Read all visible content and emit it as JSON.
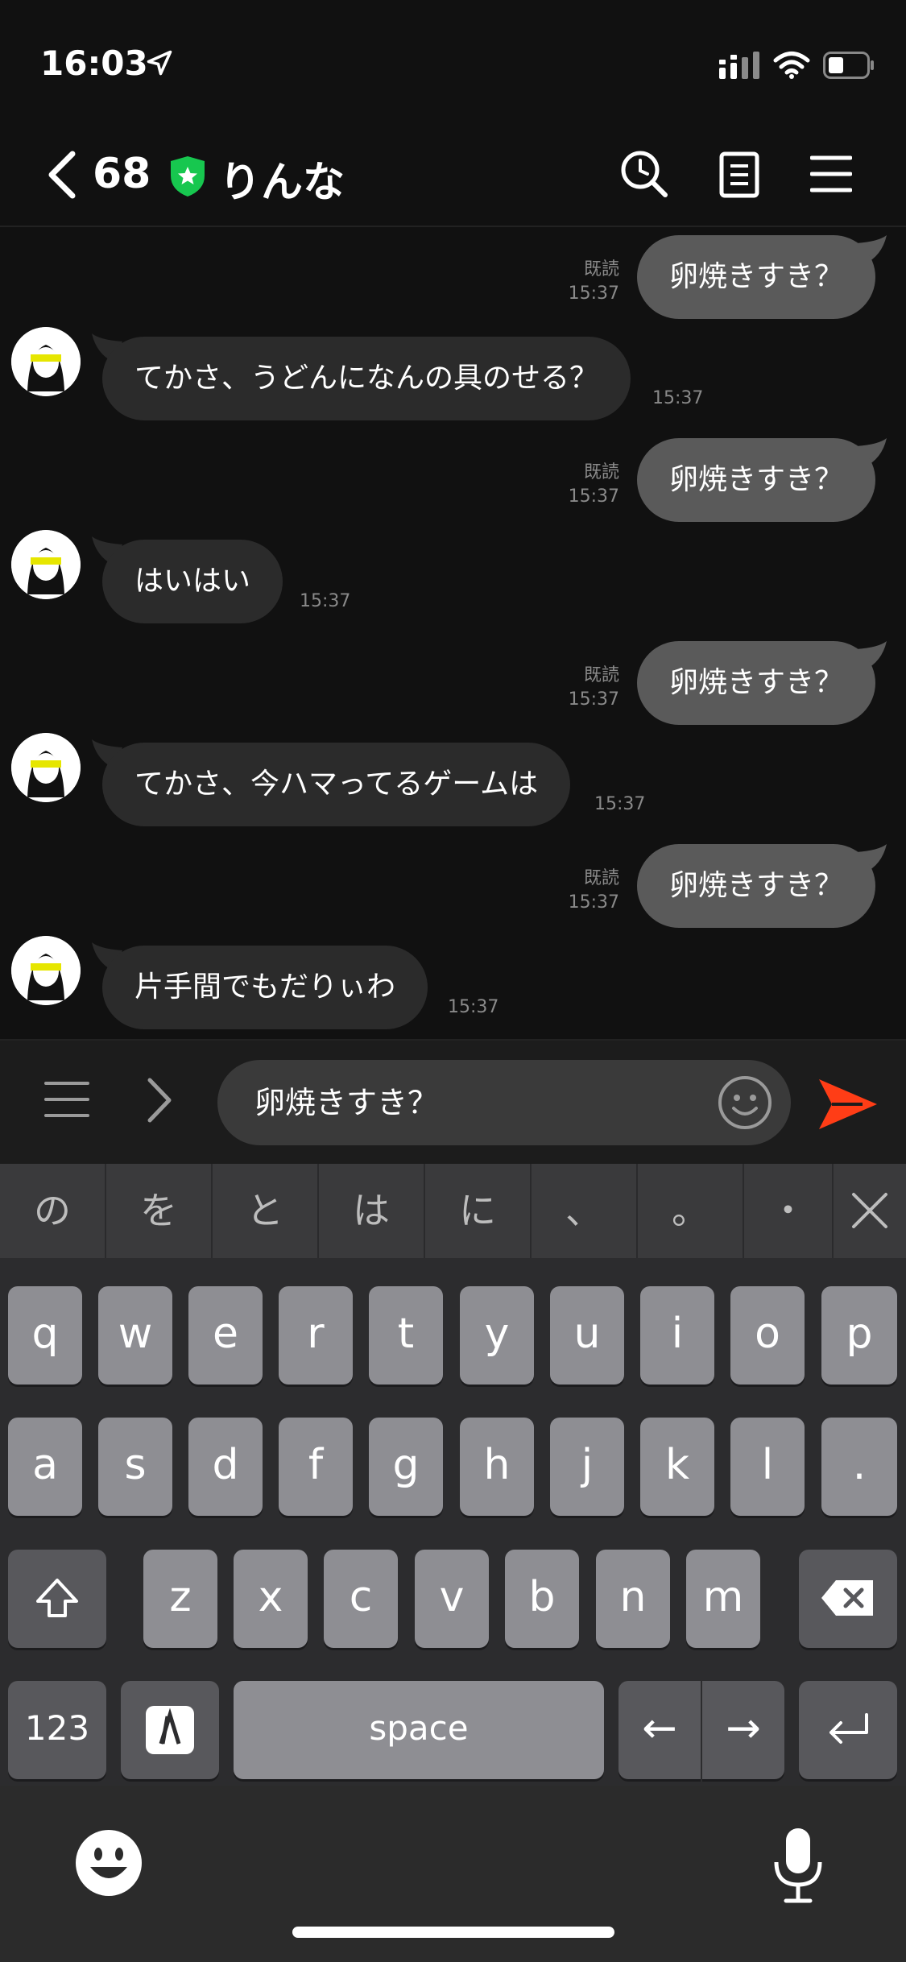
{
  "status": {
    "time": "16:03"
  },
  "header": {
    "back_count": "68",
    "name": "りんな"
  },
  "messages": [
    {
      "type": "sent",
      "text": "卵焼きすき？",
      "read": "既読",
      "time": "15:37"
    },
    {
      "type": "recv",
      "text": "てかさ、うどんになんの具のせる？",
      "time": "15:37"
    },
    {
      "type": "sent",
      "text": "卵焼きすき？",
      "read": "既読",
      "time": "15:37"
    },
    {
      "type": "recv",
      "text": "はいはい",
      "time": "15:37"
    },
    {
      "type": "sent",
      "text": "卵焼きすき？",
      "read": "既読",
      "time": "15:37"
    },
    {
      "type": "recv",
      "text": "てかさ、今ハマってるゲームは",
      "time": "15:37"
    },
    {
      "type": "sent",
      "text": "卵焼きすき？",
      "read": "既読",
      "time": "15:37"
    },
    {
      "type": "recv",
      "text": "片手間でもだりぃわ",
      "time": "15:37"
    }
  ],
  "input": {
    "value": "卵焼きすき？"
  },
  "keyboard": {
    "suggestions": [
      "の",
      "を",
      "と",
      "は",
      "に",
      "、",
      "。",
      "・"
    ],
    "row1": [
      "q",
      "w",
      "e",
      "r",
      "t",
      "y",
      "u",
      "i",
      "o",
      "p"
    ],
    "row2": [
      "a",
      "s",
      "d",
      "f",
      "g",
      "h",
      "j",
      "k",
      "l",
      "."
    ],
    "row3": [
      "z",
      "x",
      "c",
      "v",
      "b",
      "n",
      "m"
    ],
    "numbers_label": "123",
    "space_label": "space",
    "left_arrow": "←",
    "right_arrow": "→"
  },
  "colors": {
    "send": "#ff3d16",
    "shield": "#17c74f"
  }
}
